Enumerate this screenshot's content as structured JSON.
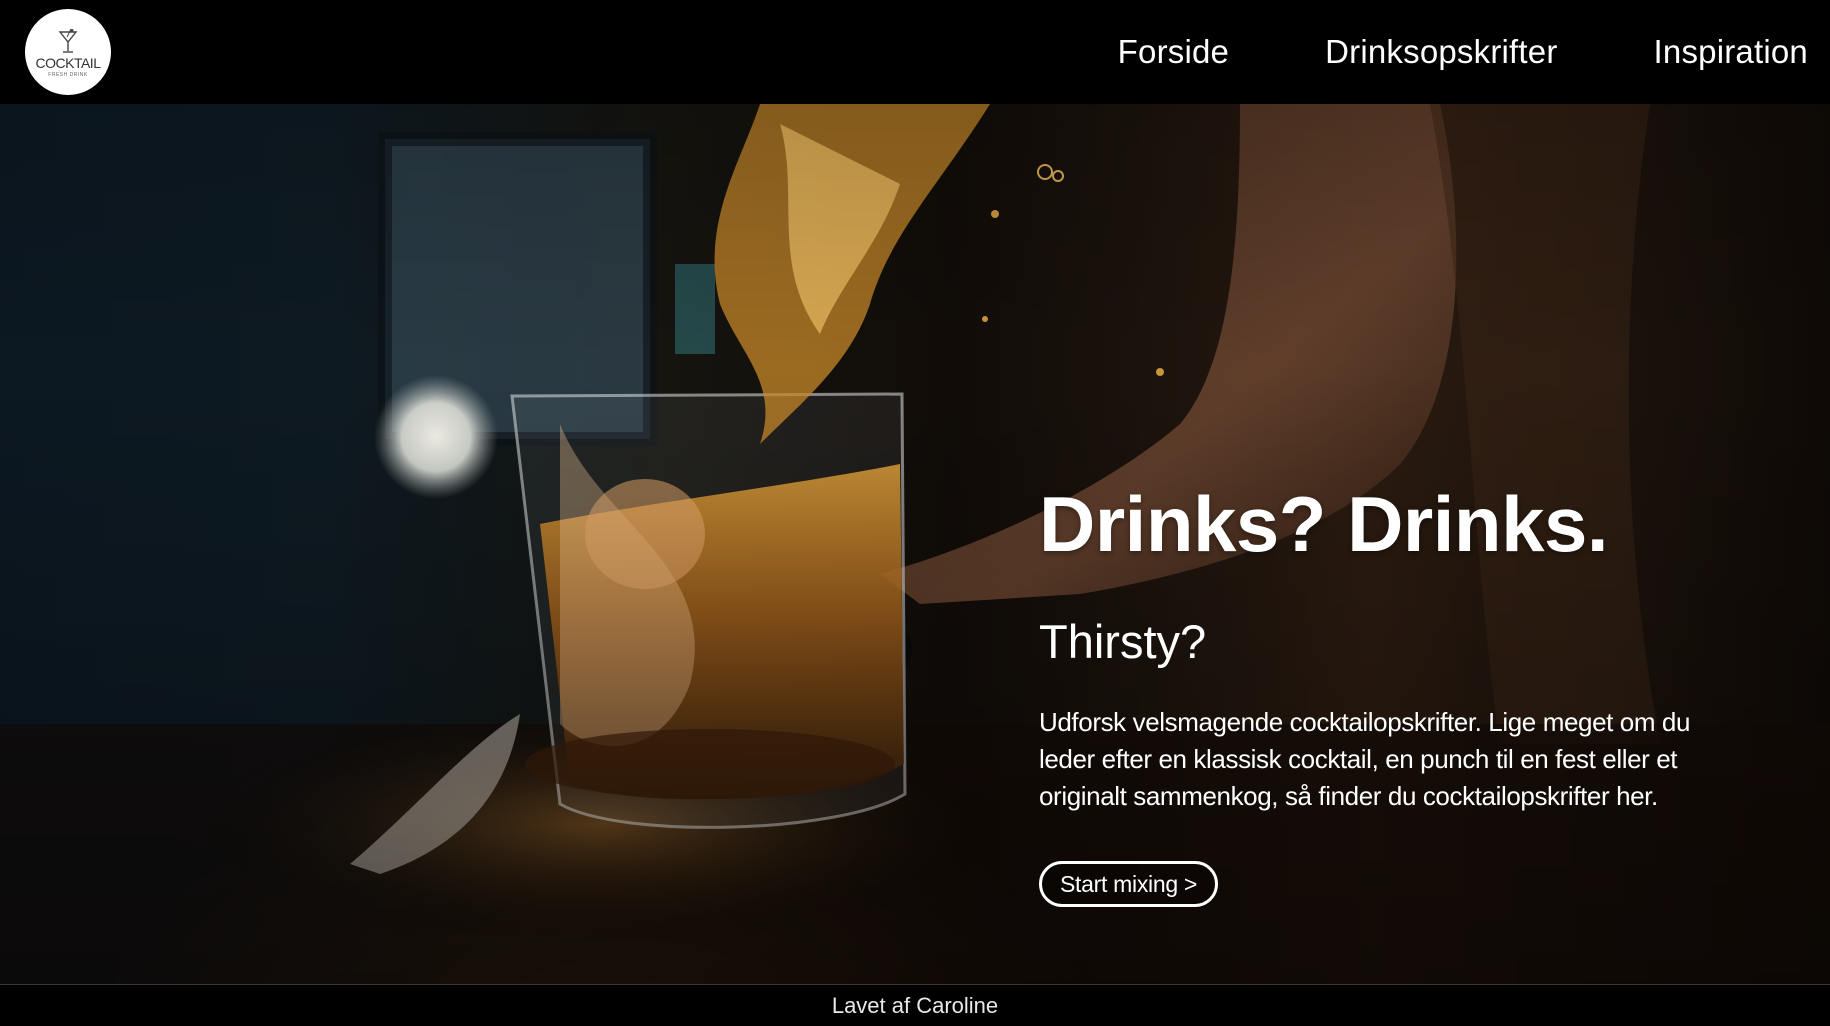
{
  "logo": {
    "title": "COCKTAIL",
    "subtitle": "FRESH DRINK"
  },
  "nav": {
    "items": [
      {
        "label": "Forside"
      },
      {
        "label": "Drinksopskrifter"
      },
      {
        "label": "Inspiration"
      }
    ]
  },
  "hero": {
    "title": "Drinks? Drinks.",
    "subtitle": "Thirsty?",
    "text": "Udforsk velsmagende cocktailopskrifter. Lige meget om du leder efter en klassisk cocktail, en punch til en fest eller et originalt sammenkog, så finder du cocktailopskrifter her.",
    "cta_label": "Start mixing >"
  },
  "footer": {
    "text": "Lavet af Caroline"
  }
}
